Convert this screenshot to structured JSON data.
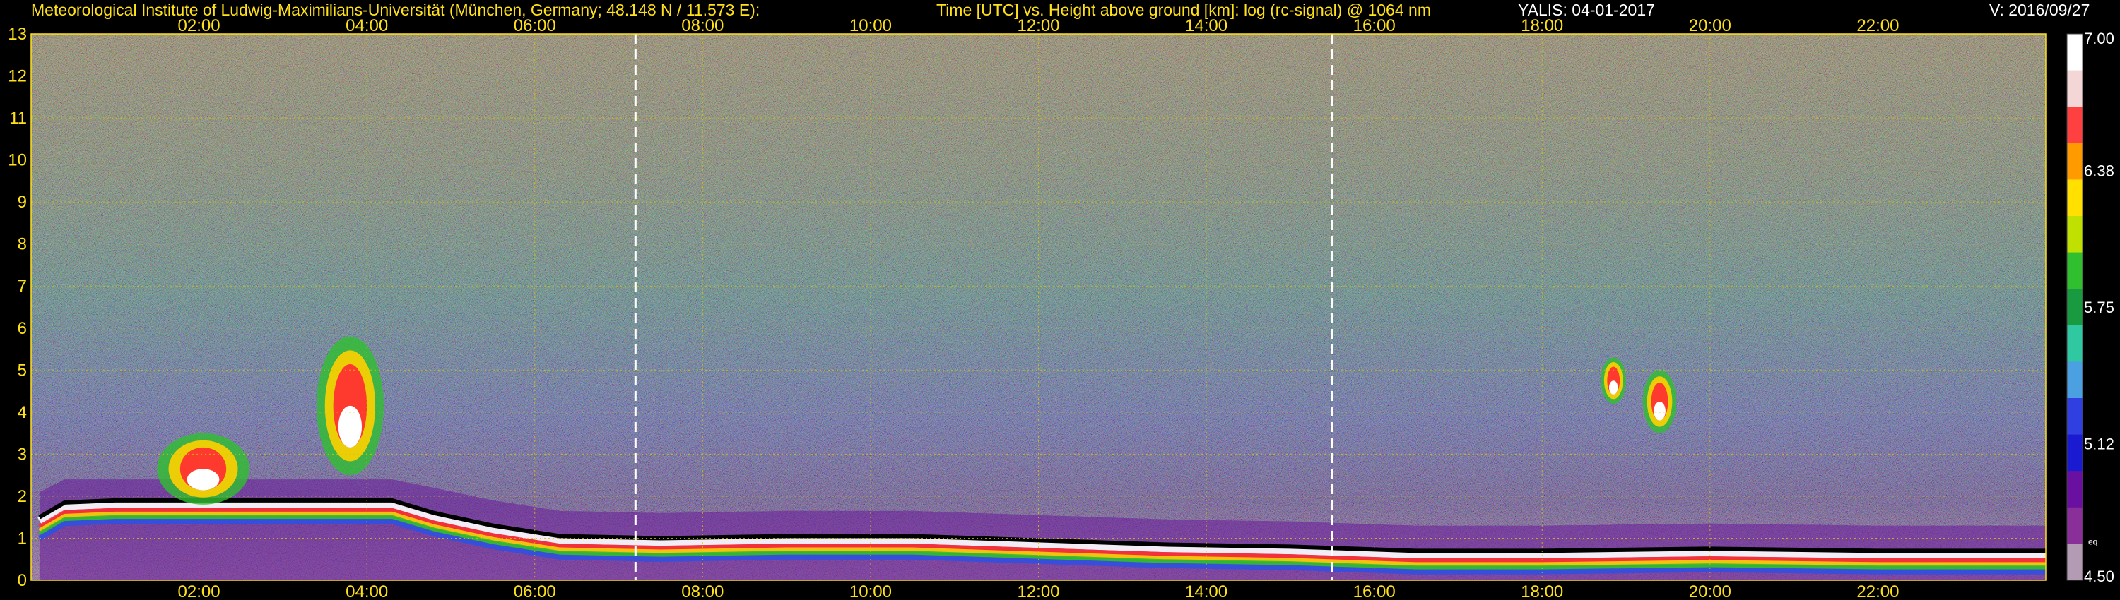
{
  "header": {
    "institute": "Meteorological Institute of Ludwig-Maximilians-Universität (München, Germany; 48.148 N / 11.573 E):",
    "title": "Time [UTC] vs. Height above ground [km]: log (rc-signal) @ 1064 nm",
    "station_date": "YALIS: 04-01-2017",
    "version": "V: 2016/09/27"
  },
  "colors": {
    "background": "#000000",
    "axis_text": "#ffe11a",
    "grid": "#d8c800",
    "marker_lines": "#ffffff",
    "colorbar": [
      "#ffffff",
      "#f4d6d6",
      "#ff4040",
      "#ff9b00",
      "#ffe000",
      "#bfe000",
      "#2fbf2f",
      "#1a9a40",
      "#2fc8a0",
      "#4aa0e0",
      "#3040e0",
      "#1a1ad0",
      "#6a10a0",
      "#8a2e9a",
      "#b49bb4"
    ]
  },
  "chart_data": {
    "type": "heatmap",
    "title": "Time [UTC] vs. Height above ground [km]: log (rc-signal) @ 1064 nm",
    "xlabel": "Time [UTC]",
    "ylabel": "Height above ground [km]",
    "xlim_hours": [
      0.0,
      24.0
    ],
    "ylim_km": [
      0,
      13
    ],
    "x_ticks": [
      "02:00",
      "04:00",
      "06:00",
      "08:00",
      "10:00",
      "12:00",
      "14:00",
      "16:00",
      "18:00",
      "20:00",
      "22:00"
    ],
    "x_tick_hours": [
      2,
      4,
      6,
      8,
      10,
      12,
      14,
      16,
      18,
      20,
      22
    ],
    "y_ticks": [
      "0",
      "1",
      "2",
      "3",
      "4",
      "5",
      "6",
      "7",
      "8",
      "9",
      "10",
      "11",
      "12",
      "13"
    ],
    "colorbar": {
      "min": 4.5,
      "max": 7.0,
      "tick_labels": [
        "4.50",
        "5.12",
        "5.75",
        "6.38",
        "7.00"
      ],
      "tick_values": [
        4.5,
        5.125,
        5.75,
        6.375,
        7.0
      ],
      "note": "eq"
    },
    "grid": true,
    "vertical_markers_hours": [
      7.2,
      15.5
    ],
    "features": {
      "boundary_layer_top_km": [
        {
          "hour": 0.1,
          "km": 1.5
        },
        {
          "hour": 0.4,
          "km": 1.85
        },
        {
          "hour": 1.0,
          "km": 1.9
        },
        {
          "hour": 2.0,
          "km": 1.9
        },
        {
          "hour": 3.0,
          "km": 1.9
        },
        {
          "hour": 4.3,
          "km": 1.9
        },
        {
          "hour": 4.8,
          "km": 1.6
        },
        {
          "hour": 5.5,
          "km": 1.3
        },
        {
          "hour": 6.3,
          "km": 1.05
        },
        {
          "hour": 7.5,
          "km": 1.0
        },
        {
          "hour": 9.0,
          "km": 1.05
        },
        {
          "hour": 10.5,
          "km": 1.05
        },
        {
          "hour": 12.0,
          "km": 0.95
        },
        {
          "hour": 13.5,
          "km": 0.85
        },
        {
          "hour": 15.0,
          "km": 0.8
        },
        {
          "hour": 16.5,
          "km": 0.7
        },
        {
          "hour": 18.0,
          "km": 0.7
        },
        {
          "hour": 20.0,
          "km": 0.75
        },
        {
          "hour": 22.0,
          "km": 0.7
        },
        {
          "hour": 24.0,
          "km": 0.7
        }
      ],
      "clouds": [
        {
          "hour_start": 1.5,
          "hour_end": 2.6,
          "km_bottom": 1.8,
          "km_top": 3.5
        },
        {
          "hour_start": 3.4,
          "hour_end": 4.2,
          "km_bottom": 2.5,
          "km_top": 5.8
        },
        {
          "hour_start": 18.7,
          "hour_end": 19.0,
          "km_bottom": 4.2,
          "km_top": 5.3
        },
        {
          "hour_start": 19.2,
          "hour_end": 19.6,
          "km_bottom": 3.5,
          "km_top": 5.0
        }
      ]
    }
  }
}
